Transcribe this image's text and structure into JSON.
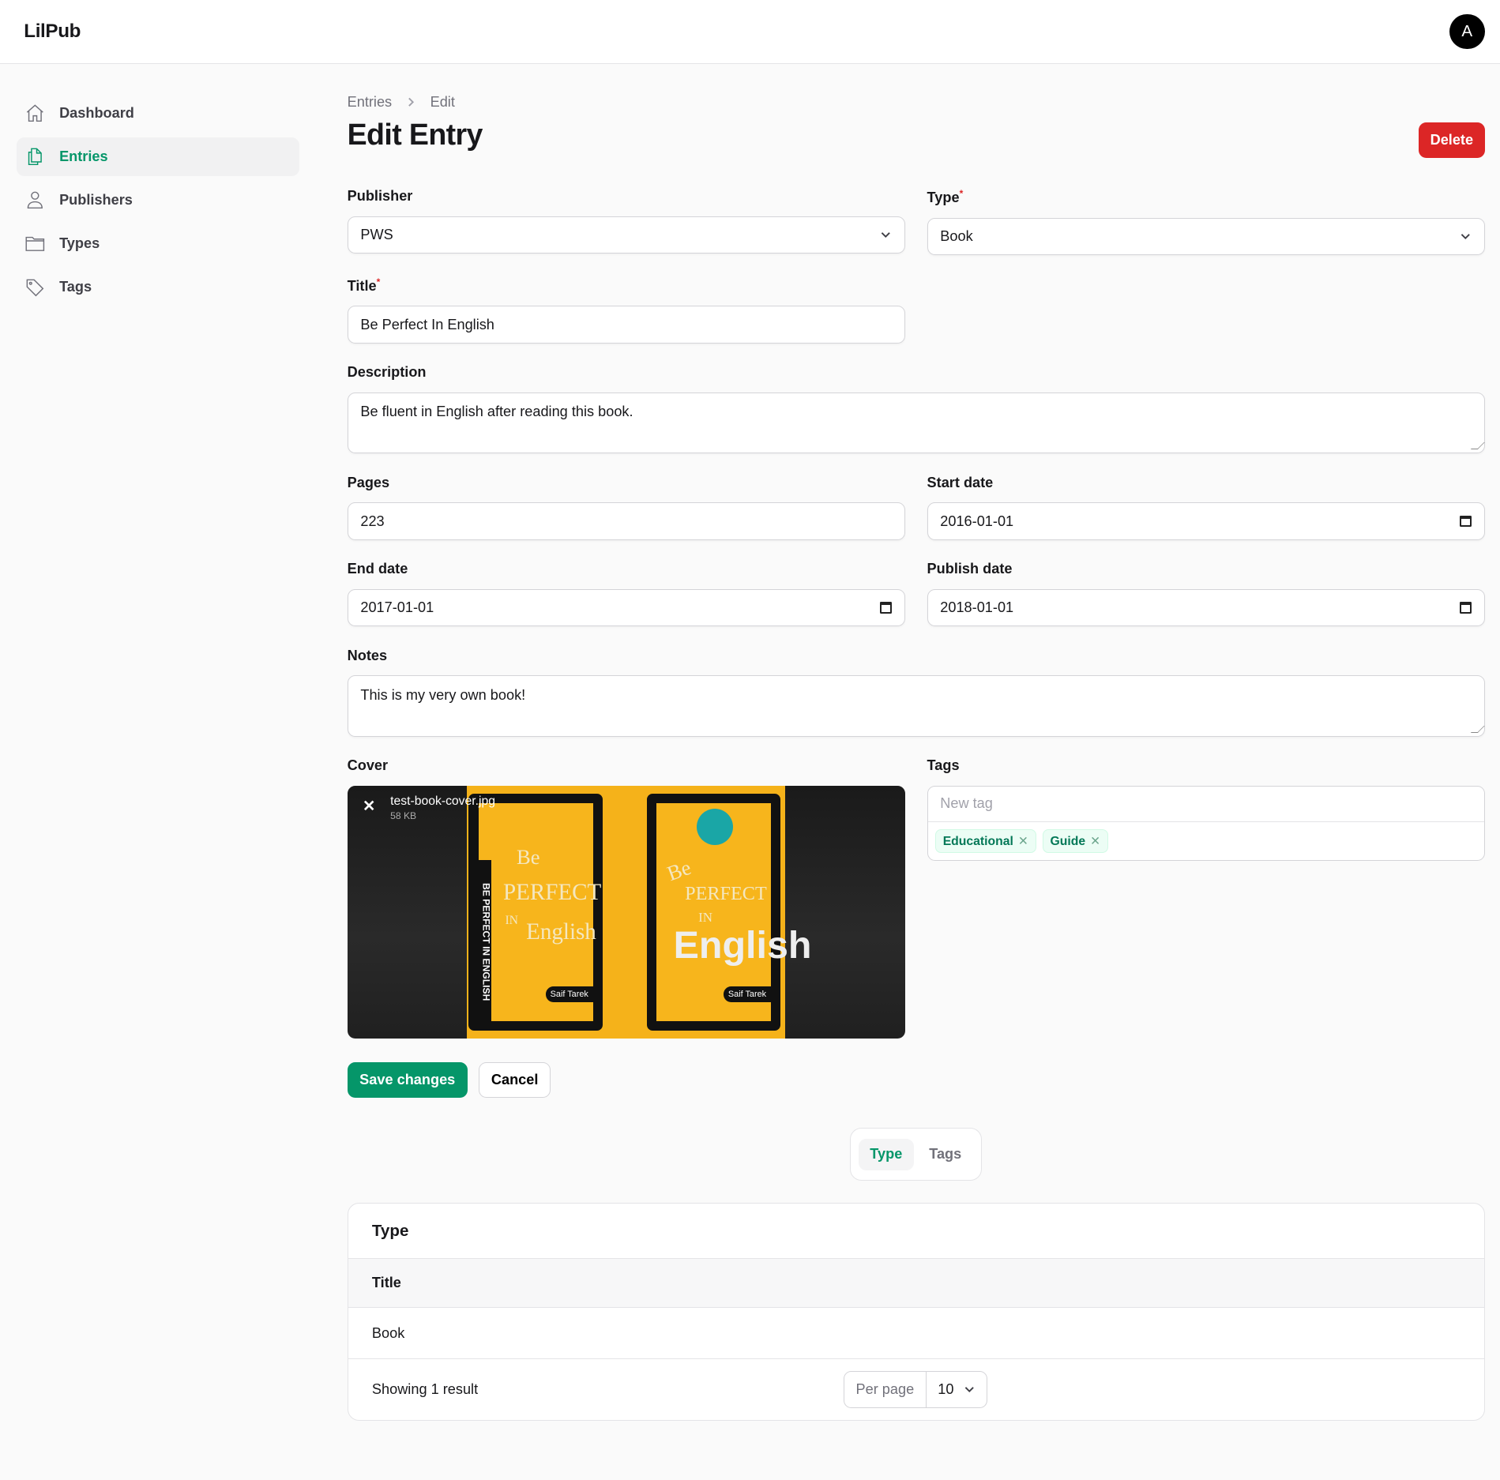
{
  "app": {
    "name": "LilPub",
    "avatar": "A"
  },
  "sidebar": {
    "items": [
      {
        "label": "Dashboard"
      },
      {
        "label": "Entries"
      },
      {
        "label": "Publishers"
      },
      {
        "label": "Types"
      },
      {
        "label": "Tags"
      }
    ]
  },
  "breadcrumb": [
    "Entries",
    "Edit"
  ],
  "page": {
    "title": "Edit Entry",
    "delete": "Delete"
  },
  "form": {
    "publisher": {
      "label": "Publisher",
      "value": "PWS"
    },
    "type": {
      "label": "Type",
      "value": "Book"
    },
    "title": {
      "label": "Title",
      "value": "Be Perfect In English"
    },
    "description": {
      "label": "Description",
      "value": "Be fluent in English after reading this book."
    },
    "pages": {
      "label": "Pages",
      "value": "223"
    },
    "start_date": {
      "label": "Start date",
      "value": "2016-01-01"
    },
    "end_date": {
      "label": "End date",
      "value": "2017-01-01"
    },
    "publish_date": {
      "label": "Publish date",
      "value": "2018-01-01"
    },
    "notes": {
      "label": "Notes",
      "value": "This is my very own book!"
    },
    "cover": {
      "label": "Cover",
      "file_name": "test-book-cover.jpg",
      "file_size": "58 KB",
      "cover_text": [
        "BE PERFECT IN ENGLISH",
        "Be",
        "PERFECT",
        "IN",
        "English",
        "Saif Tarek"
      ]
    },
    "tags": {
      "label": "Tags",
      "placeholder": "New tag",
      "items": [
        "Educational",
        "Guide"
      ]
    },
    "save": "Save changes",
    "cancel": "Cancel"
  },
  "relations": {
    "tabs": [
      "Type",
      "Tags"
    ],
    "table": {
      "heading": "Type",
      "column": "Title",
      "rows": [
        "Book"
      ],
      "summary": "Showing 1 result",
      "per_page_label": "Per page",
      "per_page": "10"
    }
  }
}
